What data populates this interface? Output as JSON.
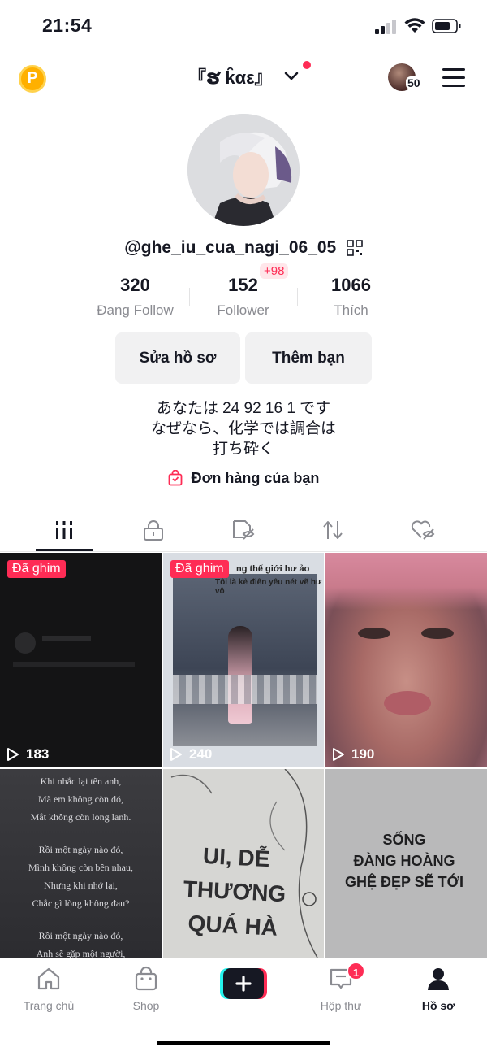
{
  "status": {
    "time": "21:54"
  },
  "header": {
    "coin_icon_text": "P",
    "nickname": "『ຮ k̑αε』",
    "avatar_count": "50"
  },
  "profile": {
    "username": "@ghe_iu_cua_nagi_06_05",
    "stats": [
      {
        "value": "320",
        "label": "Đang Follow"
      },
      {
        "value": "152",
        "label": "Follower",
        "badge": "+98"
      },
      {
        "value": "1066",
        "label": "Thích"
      }
    ],
    "buttons": {
      "edit": "Sửa hồ sơ",
      "add_friend": "Thêm bạn"
    },
    "bio_lines": [
      "あなたは 24 92 16 1 です",
      "なぜなら、化学では調合は",
      "打ち砕く"
    ],
    "orders_label": "Đơn hàng của bạn"
  },
  "tabs": [
    "videos-icon",
    "lock-icon",
    "tag-hidden-icon",
    "repost-icon",
    "liked-hidden-icon"
  ],
  "videos": [
    {
      "pinned_label": "Đã ghim",
      "views": "183"
    },
    {
      "pinned_label": "Đã ghim",
      "views": "240",
      "overlay_text": [
        "ng thế giới hư ảo",
        "Tôi là kẻ điên yêu nét vẽ hư vô"
      ]
    },
    {
      "views": "190"
    },
    {
      "overlay_text": [
        "Khi nhắc lại tên anh,",
        "Mà em không còn đó,",
        "Mắt không còn long lanh.",
        "Rồi một ngày nào đó,",
        "Mình không còn bên nhau,",
        "Nhưng khi nhớ lại,",
        "Chắc gì lòng không đau?",
        "Rồi một ngày nào đó,",
        "Anh sẽ gặp một người,"
      ]
    },
    {
      "overlay_text": [
        "UI, DỄ",
        "THƯƠNG",
        "QUÁ HÀ"
      ]
    },
    {
      "overlay_text": [
        "SỐNG",
        "ĐÀNG HOÀNG",
        "GHỆ ĐẸP SẼ TỚI"
      ]
    }
  ],
  "bottom_nav": {
    "home": "Trang chủ",
    "shop": "Shop",
    "inbox": "Hộp thư",
    "inbox_badge": "1",
    "profile": "Hồ sơ"
  },
  "colors": {
    "accent": "#fe2c55",
    "coin": "#ffb000",
    "text": "#161823",
    "muted": "#8a8b91"
  }
}
